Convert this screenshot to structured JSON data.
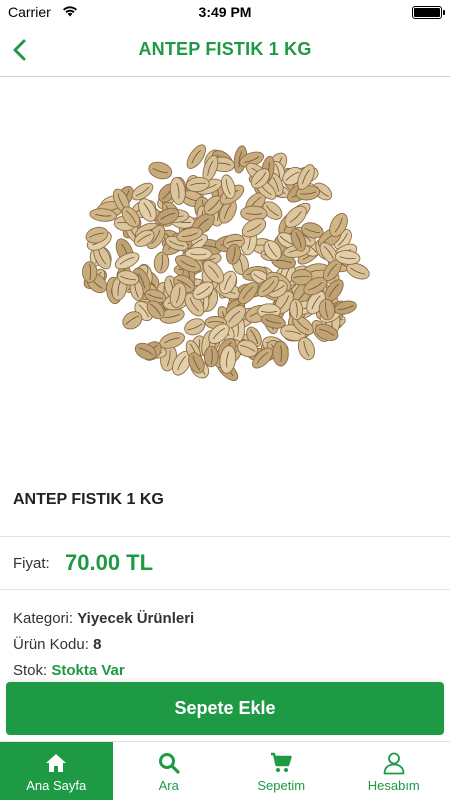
{
  "status_bar": {
    "carrier": "Carrier",
    "time": "3:49 PM"
  },
  "nav": {
    "title": "ANTEP FISTIK 1 KG",
    "back_icon": "chevron-left-icon"
  },
  "product": {
    "name": "ANTEP FISTIK 1 KG",
    "price_label": "Fiyat:",
    "price": "70.00 TL",
    "category_label": "Kategori:",
    "category": "Yiyecek Ürünleri",
    "code_label": "Ürün Kodu:",
    "code": "8",
    "stock_label": "Stok:",
    "stock": "Stokta Var"
  },
  "actions": {
    "add_to_cart": "Sepete Ekle"
  },
  "tabs": [
    {
      "label": "Ana Sayfa",
      "icon": "home-icon",
      "active": true
    },
    {
      "label": "Ara",
      "icon": "search-icon",
      "active": false
    },
    {
      "label": "Sepetim",
      "icon": "cart-icon",
      "active": false
    },
    {
      "label": "Hesabım",
      "icon": "user-icon",
      "active": false
    }
  ],
  "colors": {
    "accent": "#1e9a45",
    "divider": "#e3e3e3"
  }
}
